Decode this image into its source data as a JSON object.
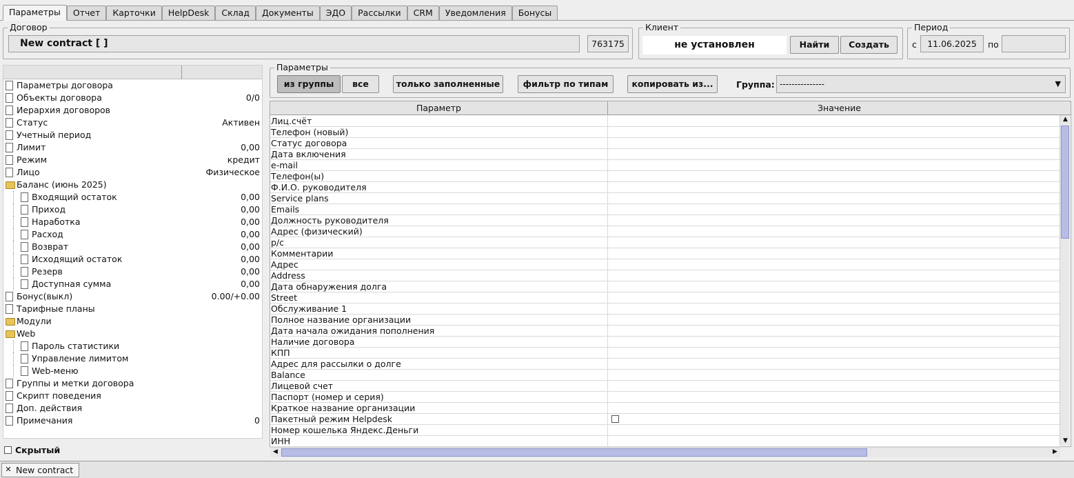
{
  "tabs": [
    "Параметры",
    "Отчет",
    "Карточки",
    "HelpDesk",
    "Склад",
    "Документы",
    "ЭДО",
    "Рассылки",
    "CRM",
    "Уведомления",
    "Бонусы"
  ],
  "active_tab": "Параметры",
  "contract": {
    "group_title": "Договор",
    "title": "New contract [  ]",
    "id": "763175"
  },
  "client": {
    "group_title": "Клиент",
    "value": "не установлен",
    "find_button": "Найти",
    "create_button": "Создать"
  },
  "period": {
    "group_title": "Период",
    "from_label": "с",
    "from_value": "11.06.2025",
    "to_label": "по",
    "to_value": ""
  },
  "tree": {
    "items": [
      {
        "label": "Параметры договора",
        "value": "",
        "level": 0,
        "icon": "doc"
      },
      {
        "label": "Объекты договора",
        "value": "0/0",
        "level": 0,
        "icon": "doc"
      },
      {
        "label": "Иерархия договоров",
        "value": "",
        "level": 0,
        "icon": "doc"
      },
      {
        "label": "Статус",
        "value": "Активен",
        "level": 0,
        "icon": "doc"
      },
      {
        "label": "Учетный период",
        "value": "",
        "level": 0,
        "icon": "doc"
      },
      {
        "label": "Лимит",
        "value": "0,00",
        "level": 0,
        "icon": "doc"
      },
      {
        "label": "Режим",
        "value": "кредит",
        "level": 0,
        "icon": "doc"
      },
      {
        "label": "Лицо",
        "value": "Физическое",
        "level": 0,
        "icon": "doc"
      },
      {
        "label": "Баланс (июнь 2025)",
        "value": "",
        "level": 0,
        "icon": "folder"
      },
      {
        "label": "Входящий остаток",
        "value": "0,00",
        "level": 1,
        "icon": "doc"
      },
      {
        "label": "Приход",
        "value": "0,00",
        "level": 1,
        "icon": "doc"
      },
      {
        "label": "Наработка",
        "value": "0,00",
        "level": 1,
        "icon": "doc"
      },
      {
        "label": "Расход",
        "value": "0,00",
        "level": 1,
        "icon": "doc"
      },
      {
        "label": "Возврат",
        "value": "0,00",
        "level": 1,
        "icon": "doc"
      },
      {
        "label": "Исходящий остаток",
        "value": "0,00",
        "level": 1,
        "icon": "doc"
      },
      {
        "label": "Резерв",
        "value": "0,00",
        "level": 1,
        "icon": "doc"
      },
      {
        "label": "Доступная сумма",
        "value": "0,00",
        "level": 1,
        "icon": "doc"
      },
      {
        "label": "Бонус(выкл)",
        "value": "0.00/+0.00",
        "level": 0,
        "icon": "doc"
      },
      {
        "label": "Тарифные планы",
        "value": "",
        "level": 0,
        "icon": "doc"
      },
      {
        "label": "Модули",
        "value": "",
        "level": 0,
        "icon": "folder"
      },
      {
        "label": "Web",
        "value": "",
        "level": 0,
        "icon": "folder"
      },
      {
        "label": "Пароль статистики",
        "value": "",
        "level": 1,
        "icon": "doc"
      },
      {
        "label": "Управление лимитом",
        "value": "",
        "level": 1,
        "icon": "doc"
      },
      {
        "label": "Web-меню",
        "value": "",
        "level": 1,
        "icon": "doc"
      },
      {
        "label": "Группы и метки договора",
        "value": "",
        "level": 0,
        "icon": "doc"
      },
      {
        "label": "Скрипт поведения",
        "value": "",
        "level": 0,
        "icon": "doc"
      },
      {
        "label": "Доп. действия",
        "value": "",
        "level": 0,
        "icon": "doc"
      },
      {
        "label": "Примечания",
        "value": "0",
        "level": 0,
        "icon": "doc"
      }
    ]
  },
  "hidden_checkbox_label": "Скрытый",
  "params": {
    "group_title": "Параметры",
    "buttons": {
      "from_group": "из группы",
      "all": "все",
      "only_filled": "только заполненные",
      "filter_types": "фильтр по типам",
      "copy_from": "копировать из..."
    },
    "group_label": "Группа:",
    "group_value": "---------------",
    "columns": [
      "Параметр",
      "Значение"
    ],
    "rows": [
      {
        "name": "Лиц.счёт",
        "checkbox": false
      },
      {
        "name": "Телефон (новый)",
        "checkbox": false
      },
      {
        "name": "Статус договора",
        "checkbox": false
      },
      {
        "name": "Дата включения",
        "checkbox": false
      },
      {
        "name": "e-mail",
        "checkbox": false
      },
      {
        "name": "Телефон(ы)",
        "checkbox": false
      },
      {
        "name": "Ф.И.О. руководителя",
        "checkbox": false
      },
      {
        "name": "Service plans",
        "checkbox": false
      },
      {
        "name": "Emails",
        "checkbox": false
      },
      {
        "name": "Должность руководителя",
        "checkbox": false
      },
      {
        "name": "Адрес (физический)",
        "checkbox": false
      },
      {
        "name": "р/с",
        "checkbox": false
      },
      {
        "name": "Комментарии",
        "checkbox": false
      },
      {
        "name": "Адрес",
        "checkbox": false
      },
      {
        "name": "Address",
        "checkbox": false
      },
      {
        "name": "Дата обнаружения долга",
        "checkbox": false
      },
      {
        "name": "Street",
        "checkbox": false
      },
      {
        "name": "Обслуживание 1",
        "checkbox": false
      },
      {
        "name": "Полное название организации",
        "checkbox": false
      },
      {
        "name": "Дата начала ожидания пополнения",
        "checkbox": false
      },
      {
        "name": "Наличие договора",
        "checkbox": false
      },
      {
        "name": "КПП",
        "checkbox": false
      },
      {
        "name": "Адрес для рассылки о долге",
        "checkbox": false
      },
      {
        "name": "Balance",
        "checkbox": false
      },
      {
        "name": "Лицевой счет",
        "checkbox": false
      },
      {
        "name": "Паспорт (номер и серия)",
        "checkbox": false
      },
      {
        "name": "Краткое название организации",
        "checkbox": false
      },
      {
        "name": "Пакетный режим Helpdesk",
        "checkbox": true
      },
      {
        "name": "Номер кошелька Яндекс.Деньги",
        "checkbox": false
      },
      {
        "name": "ИНН",
        "checkbox": false
      }
    ]
  },
  "bottom_tab": {
    "close_glyph": "✕",
    "label": "New contract"
  },
  "icons": {
    "dropdown": "▼",
    "up": "▲",
    "down": "▼",
    "left": "◀",
    "right": "▶"
  }
}
